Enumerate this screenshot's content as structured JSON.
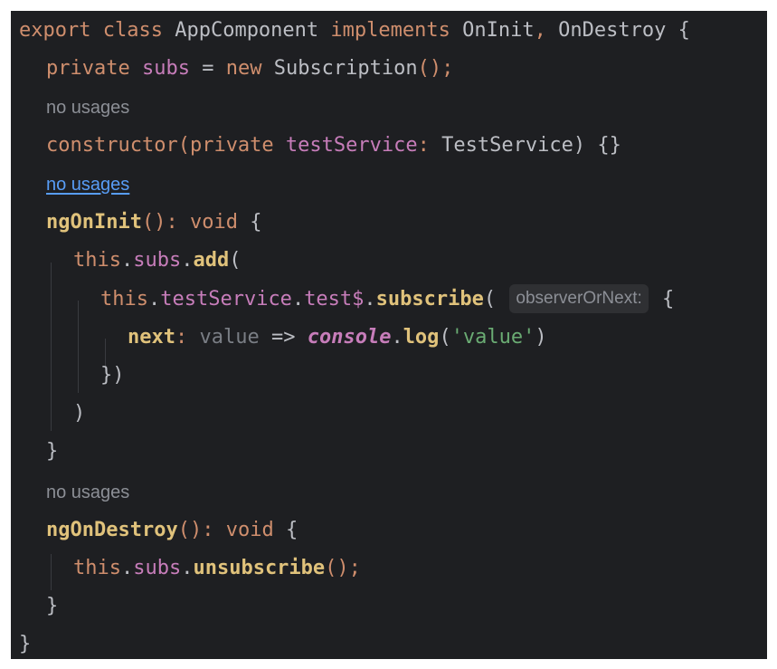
{
  "code": {
    "line1": {
      "kw_export": "export",
      "kw_class": "class",
      "class_name": "AppComponent",
      "kw_implements": "implements",
      "iface1": "OnInit",
      "comma": ",",
      "iface2": "OnDestroy",
      "brace": "{"
    },
    "line2": {
      "kw_private": "private",
      "field": "subs",
      "eq": "=",
      "kw_new": "new",
      "type": "Subscription",
      "rest": "();"
    },
    "hint_no_usages_1": "no usages",
    "line3": {
      "kw_constructor": "constructor",
      "open": "(",
      "kw_private": "private",
      "param": "testService",
      "colon": ":",
      "type": "TestService",
      "rest": ") {}"
    },
    "hint_no_usages_2": "no usages",
    "line4": {
      "method": "ngOnInit",
      "parens": "():",
      "kw_void": "void",
      "brace": "{"
    },
    "line5": {
      "kw_this": "this",
      "dot1": ".",
      "field": "subs",
      "dot2": ".",
      "method": "add",
      "open": "("
    },
    "line6": {
      "kw_this": "this",
      "dot1": ".",
      "field": "testService",
      "dot2": ".",
      "field2": "test$",
      "dot3": ".",
      "method": "subscribe",
      "open": "(",
      "inlay_hint": "observerOrNext:",
      "brace": "{"
    },
    "line7": {
      "key": "next",
      "colon": ":",
      "param": "value",
      "arrow": "=>",
      "global": "console",
      "dot": ".",
      "method": "log",
      "open": "(",
      "string": "'value'",
      "close": ")"
    },
    "line8": "})",
    "line9": ")",
    "line10": "}",
    "hint_no_usages_3": "no usages",
    "line11": {
      "method": "ngOnDestroy",
      "parens": "():",
      "kw_void": "void",
      "brace": "{"
    },
    "line12": {
      "kw_this": "this",
      "dot1": ".",
      "field": "subs",
      "dot2": ".",
      "method": "unsubscribe",
      "rest": "();"
    },
    "line13": "}",
    "line14": "}"
  },
  "colors": {
    "background": "#1e1f22",
    "keyword": "#cf8e6d",
    "field": "#c77dba",
    "method": "#56a8f5",
    "string": "#6aab73",
    "text": "#bcbec4",
    "hint": "#8c8f96",
    "link": "#589df6"
  }
}
